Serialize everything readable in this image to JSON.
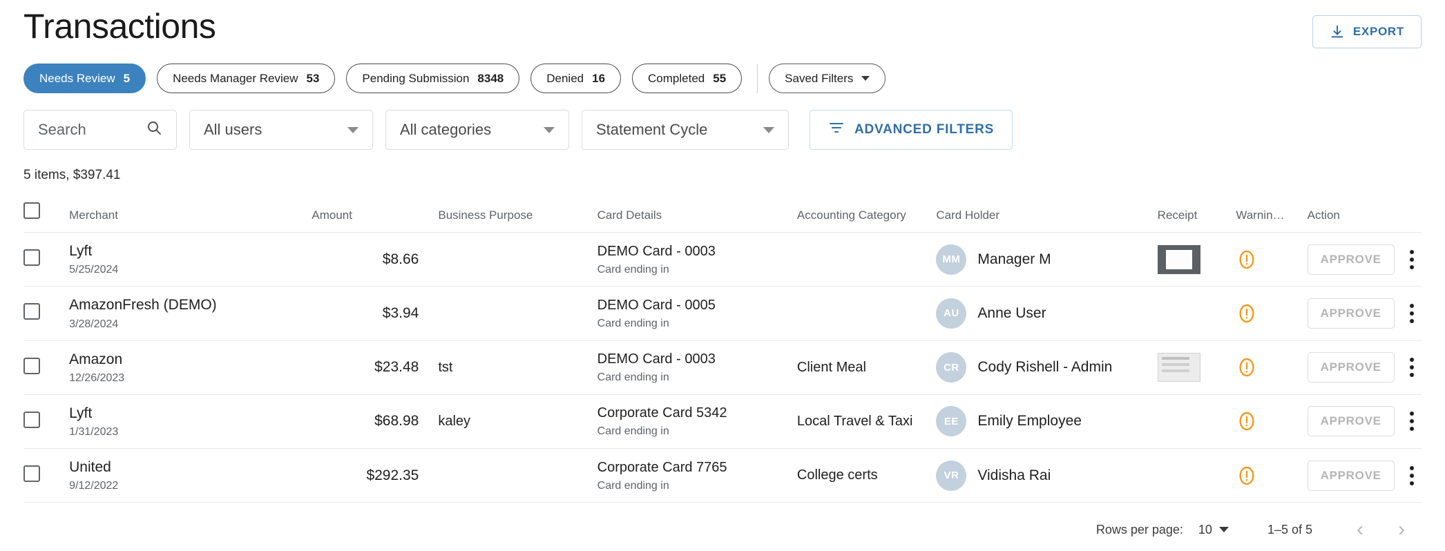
{
  "header": {
    "title": "Transactions",
    "export_label": "EXPORT",
    "export_icon": "download-icon"
  },
  "status_chips": [
    {
      "label": "Needs Review",
      "count": "5",
      "active": true
    },
    {
      "label": "Needs Manager Review",
      "count": "53",
      "active": false
    },
    {
      "label": "Pending Submission",
      "count": "8348",
      "active": false
    },
    {
      "label": "Denied",
      "count": "16",
      "active": false
    },
    {
      "label": "Completed",
      "count": "55",
      "active": false
    }
  ],
  "saved_filters": {
    "label": "Saved Filters",
    "icon": "chevron-down-icon"
  },
  "filters": {
    "search_placeholder": "Search",
    "search_value": "",
    "search_icon": "search-icon",
    "users_value": "All users",
    "categories_value": "All categories",
    "cycle_value": "Statement Cycle",
    "advanced_label": "ADVANCED FILTERS",
    "advanced_icon": "filter-icon"
  },
  "summary": "5 items, $397.41",
  "table": {
    "columns": [
      "Merchant",
      "Amount",
      "Business Purpose",
      "Card Details",
      "Accounting Category",
      "Card Holder",
      "Receipt",
      "Warnin…",
      "Action"
    ],
    "rows": [
      {
        "merchant": "Lyft",
        "date": "5/25/2024",
        "amount": "$8.66",
        "business_purpose": "",
        "card_name": "DEMO Card - 0003",
        "card_sub": "Card ending in",
        "accounting_category": "",
        "holder_initials": "MM",
        "holder_name": "Manager M",
        "receipt": "dark",
        "warning": true,
        "action_label": "APPROVE"
      },
      {
        "merchant": "AmazonFresh (DEMO)",
        "date": "3/28/2024",
        "amount": "$3.94",
        "business_purpose": "",
        "card_name": "DEMO Card - 0005",
        "card_sub": "Card ending in",
        "accounting_category": "",
        "holder_initials": "AU",
        "holder_name": "Anne User",
        "receipt": "none",
        "warning": true,
        "action_label": "APPROVE"
      },
      {
        "merchant": "Amazon",
        "date": "12/26/2023",
        "amount": "$23.48",
        "business_purpose": "tst",
        "card_name": "DEMO Card - 0003",
        "card_sub": "Card ending in",
        "accounting_category": "Client Meal",
        "holder_initials": "CR",
        "holder_name": "Cody Rishell - Admin",
        "receipt": "light",
        "warning": true,
        "action_label": "APPROVE"
      },
      {
        "merchant": "Lyft",
        "date": "1/31/2023",
        "amount": "$68.98",
        "business_purpose": "kaley",
        "card_name": "Corporate Card 5342",
        "card_sub": "Card ending in",
        "accounting_category": "Local Travel & Taxi",
        "holder_initials": "EE",
        "holder_name": "Emily Employee",
        "receipt": "none",
        "warning": true,
        "action_label": "APPROVE"
      },
      {
        "merchant": "United",
        "date": "9/12/2022",
        "amount": "$292.35",
        "business_purpose": "",
        "card_name": "Corporate Card 7765",
        "card_sub": "Card ending in",
        "accounting_category": "College certs",
        "holder_initials": "VR",
        "holder_name": "Vidisha Rai",
        "receipt": "none",
        "warning": true,
        "action_label": "APPROVE"
      }
    ]
  },
  "pagination": {
    "rows_per_page_label": "Rows per page:",
    "rows_per_page_value": "10",
    "range": "1–5 of 5",
    "prev_icon": "chevron-left-icon",
    "next_icon": "chevron-right-icon"
  },
  "colors": {
    "accent_blue": "#3c82bf",
    "link_blue": "#2f6ea8",
    "warning_orange": "#f29a1f",
    "avatar_bg": "#c3d0dd"
  }
}
